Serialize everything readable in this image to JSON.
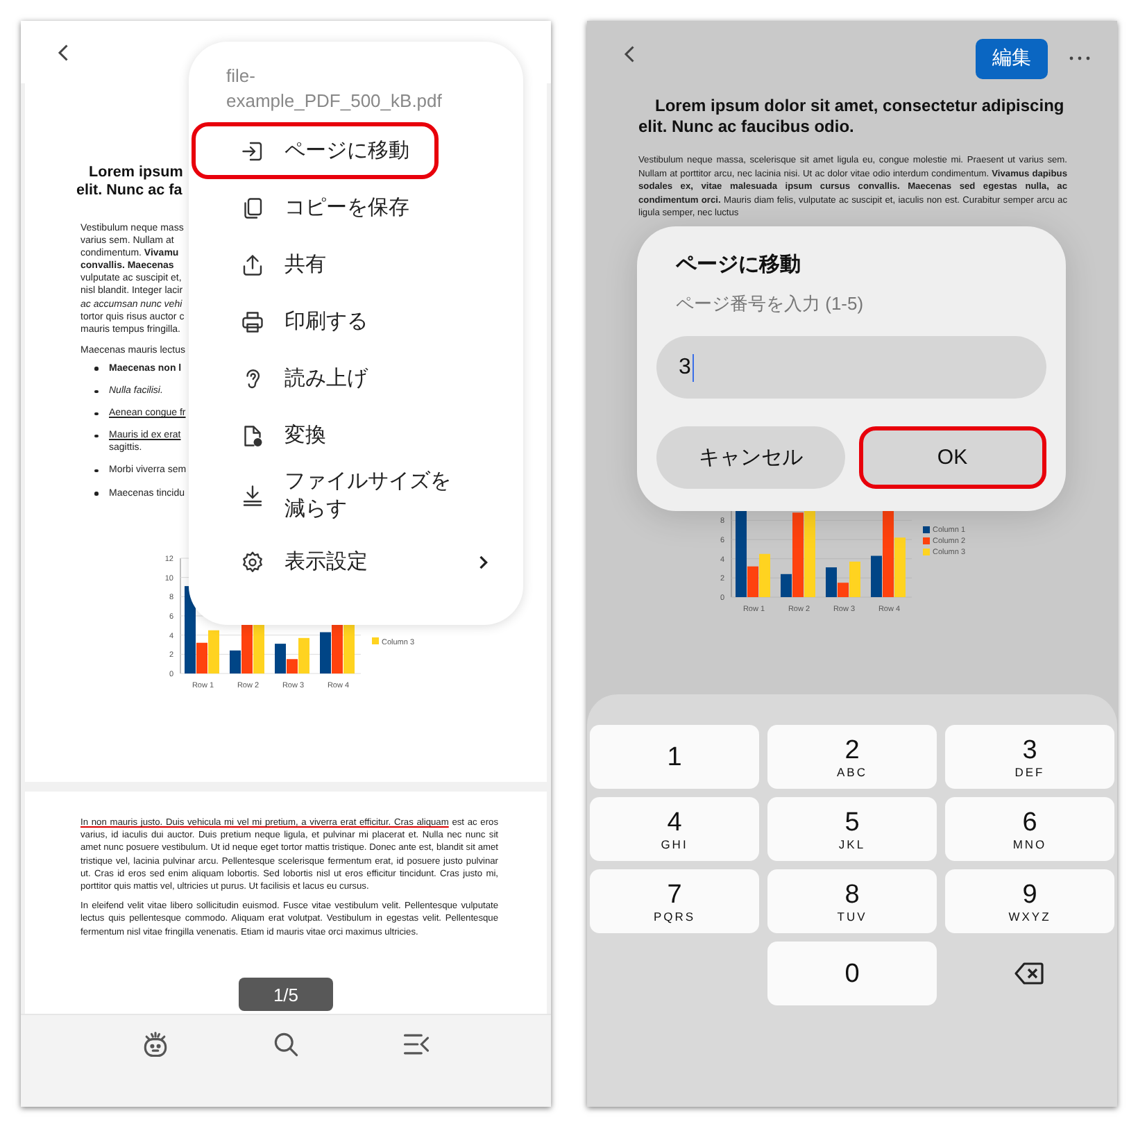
{
  "left_screen": {
    "page_1": {
      "title_lines": [
        "Lorem ipsum",
        "elit. Nunc ac fa"
      ],
      "lines": [
        {
          "text": "Vestibulum neque mass",
          "kind": "plain"
        },
        {
          "text": "varius sem. Nullam at",
          "kind": "plain"
        },
        {
          "text": "condimentum. **Vivamu**",
          "kind": "plain"
        },
        {
          "text": "convallis. Maecenas",
          "kind": "bold"
        },
        {
          "text": "vulputate ac suscipit et,",
          "kind": "plain"
        },
        {
          "text": "nisl blandit. Integer lacir",
          "kind": "plain"
        },
        {
          "text": "ac accumsan nunc vehi",
          "kind": "italic"
        },
        {
          "text": "tortor quis risus auctor c",
          "kind": "plain"
        },
        {
          "text": "mauris tempus fringilla.",
          "kind": "plain"
        }
      ],
      "second_line": "Maecenas mauris lectus",
      "bullets": [
        {
          "text": "Maecenas non l",
          "kind": "bold"
        },
        {
          "text": "Nulla facilisi.",
          "kind": "italic"
        },
        {
          "text": "Aenean congue fr",
          "kind": "underline"
        },
        {
          "text": "Mauris id ex erat",
          "kind": "underline",
          "continuation": "sagittis."
        },
        {
          "text": "Morbi viverra sem",
          "kind": "plain"
        },
        {
          "text": "Maecenas tincidu",
          "kind": "plain"
        }
      ],
      "chart": {
        "y_labels": [
          "12",
          "10",
          "8",
          "6",
          "4",
          "2",
          "0"
        ],
        "x_labels": [
          "Row 1",
          "Row 2",
          "Row 3",
          "Row 4"
        ],
        "legend": [
          {
            "name": "Column 3",
            "color": "#ffd320"
          }
        ]
      }
    },
    "page_2": {
      "paragraphs": [
        {
          "annotated": "In non mauris justo. Duis vehicula mi vel mi pretium, a viverra erat efficitur. Cras aliquam",
          "text": " est ac eros varius, id iaculis dui auctor. Duis pretium neque ligula, et pulvinar mi placerat et. Nulla nec nunc sit amet nunc posuere vestibulum. Ut id neque eget tortor mattis tristique. Donec ante est, blandit sit amet tristique vel, lacinia pulvinar arcu. Pellentesque scelerisque fermentum erat, id posuere justo pulvinar ut. Cras id eros sed enim aliquam lobortis. Sed lobortis nisl ut eros efficitur tincidunt. Cras justo mi, porttitor quis mattis vel, ultricies ut purus. Ut facilisis et lacus eu cursus."
        },
        {
          "text": "In eleifend velit vitae libero sollicitudin euismod. Fusce vitae vestibulum velit. Pellentesque vulputate lectus quis pellentesque commodo. Aliquam erat volutpat. Vestibulum in egestas velit. Pellentesque fermentum nisl vitae fringilla venenatis. Etiam id mauris vitae orci maximus ultricies."
        }
      ]
    },
    "page_indicator": "1/5",
    "menu": {
      "file_name": "file-example_PDF_500_kB.pdf",
      "items": [
        {
          "label": "ページに移動",
          "highlighted": true,
          "submenu": false
        },
        {
          "label": "コピーを保存",
          "highlighted": false,
          "submenu": false
        },
        {
          "label": "共有",
          "highlighted": false,
          "submenu": false
        },
        {
          "label": "印刷する",
          "highlighted": false,
          "submenu": false
        },
        {
          "label": "読み上げ",
          "highlighted": false,
          "submenu": false
        },
        {
          "label": "変換",
          "highlighted": false,
          "submenu": false
        },
        {
          "label": "ファイルサイズを減らす",
          "highlighted": false,
          "submenu": false
        },
        {
          "label": "表示設定",
          "highlighted": false,
          "submenu": true
        }
      ]
    }
  },
  "right_screen": {
    "edit_button": "編集",
    "page": {
      "title": "Lorem ipsum dolor sit amet, consectetur adipiscing elit. Nunc ac faucibus odio.",
      "paragraph": "Vestibulum neque massa, scelerisque sit amet ligula eu, congue molestie mi. Praesent ut varius sem. Nullam at porttitor arcu, nec lacinia nisi. Ut ac dolor vitae odio interdum condimentum. **Vivamus dapibus sodales ex, vitae malesuada ipsum cursus convallis. Maecenas sed egestas nulla, ac condimentum orci.** Mauris diam felis, vulputate ac suscipit et, iaculis non est. Curabitur semper arcu ac ligula semper, nec luctus",
      "chart": {
        "y_labels": [
          "8",
          "6",
          "4",
          "2",
          "0"
        ],
        "x_labels": [
          "Row 1",
          "Row 2",
          "Row 3",
          "Row 4"
        ],
        "legend": [
          {
            "name": "Column 1",
            "color": "#004586"
          },
          {
            "name": "Column 2",
            "color": "#ff420e"
          },
          {
            "name": "Column 3",
            "color": "#ffd320"
          }
        ]
      }
    },
    "dialog": {
      "title": "ページに移動",
      "hint": "ページ番号を入力 (1-5)",
      "value": "3",
      "buttons": [
        {
          "label": "キャンセル",
          "highlighted": false
        },
        {
          "label": "OK",
          "highlighted": true
        }
      ]
    },
    "keypad": [
      {
        "kind": "digit",
        "digit": "1"
      },
      {
        "kind": "digit",
        "digit": "2",
        "letters": "ABC"
      },
      {
        "kind": "digit",
        "digit": "3",
        "letters": "DEF"
      },
      {
        "kind": "digit",
        "digit": "4",
        "letters": "GHI"
      },
      {
        "kind": "digit",
        "digit": "5",
        "letters": "JKL"
      },
      {
        "kind": "digit",
        "digit": "6",
        "letters": "MNO"
      },
      {
        "kind": "digit",
        "digit": "7",
        "letters": "PQRS"
      },
      {
        "kind": "digit",
        "digit": "8",
        "letters": "TUV"
      },
      {
        "kind": "digit",
        "digit": "9",
        "letters": "WXYZ"
      },
      {
        "kind": "digit",
        "digit": "0"
      },
      {
        "kind": "backspace"
      }
    ]
  }
}
